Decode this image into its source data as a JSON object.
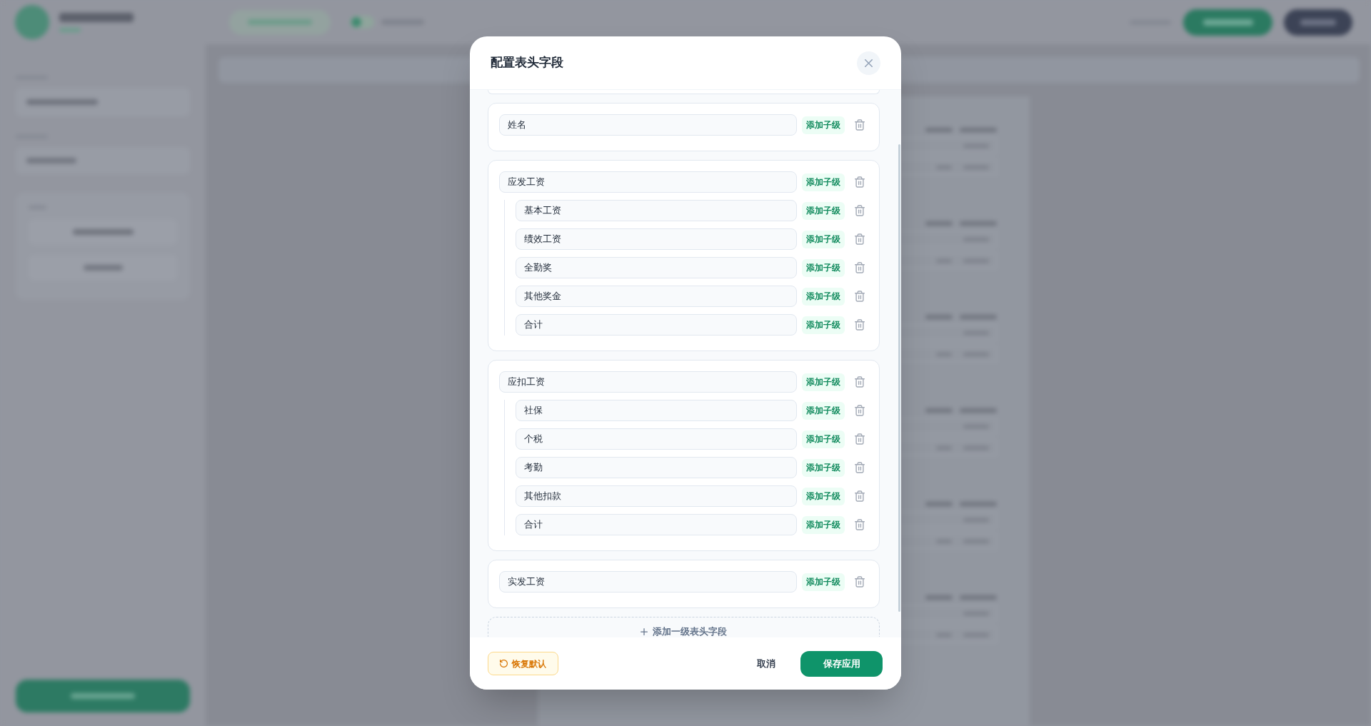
{
  "dialog": {
    "title": "配置表头字段",
    "fields": [
      {
        "value": "姓名",
        "add_child_button": "添加子级"
      },
      {
        "value": "应发工资",
        "add_child_button": "添加子级",
        "children": [
          {
            "value": "基本工资",
            "add_child_button": "添加子级"
          },
          {
            "value": "绩效工资",
            "add_child_button": "添加子级"
          },
          {
            "value": "全勤奖",
            "add_child_button": "添加子级"
          },
          {
            "value": "其他奖金",
            "add_child_button": "添加子级"
          },
          {
            "value": "合计",
            "add_child_button": "添加子级"
          }
        ]
      },
      {
        "value": "应扣工资",
        "add_child_button": "添加子级",
        "children": [
          {
            "value": "社保",
            "add_child_button": "添加子级"
          },
          {
            "value": "个税",
            "add_child_button": "添加子级"
          },
          {
            "value": "考勤",
            "add_child_button": "添加子级"
          },
          {
            "value": "其他扣款",
            "add_child_button": "添加子级"
          },
          {
            "value": "合计",
            "add_child_button": "添加子级"
          }
        ]
      },
      {
        "value": "实发工资",
        "add_child_button": "添加子级"
      }
    ],
    "add_top_level_button": "添加一级表头字段",
    "reset_button": "恢复默认",
    "cancel_button": "取消",
    "save_button": "保存应用"
  }
}
